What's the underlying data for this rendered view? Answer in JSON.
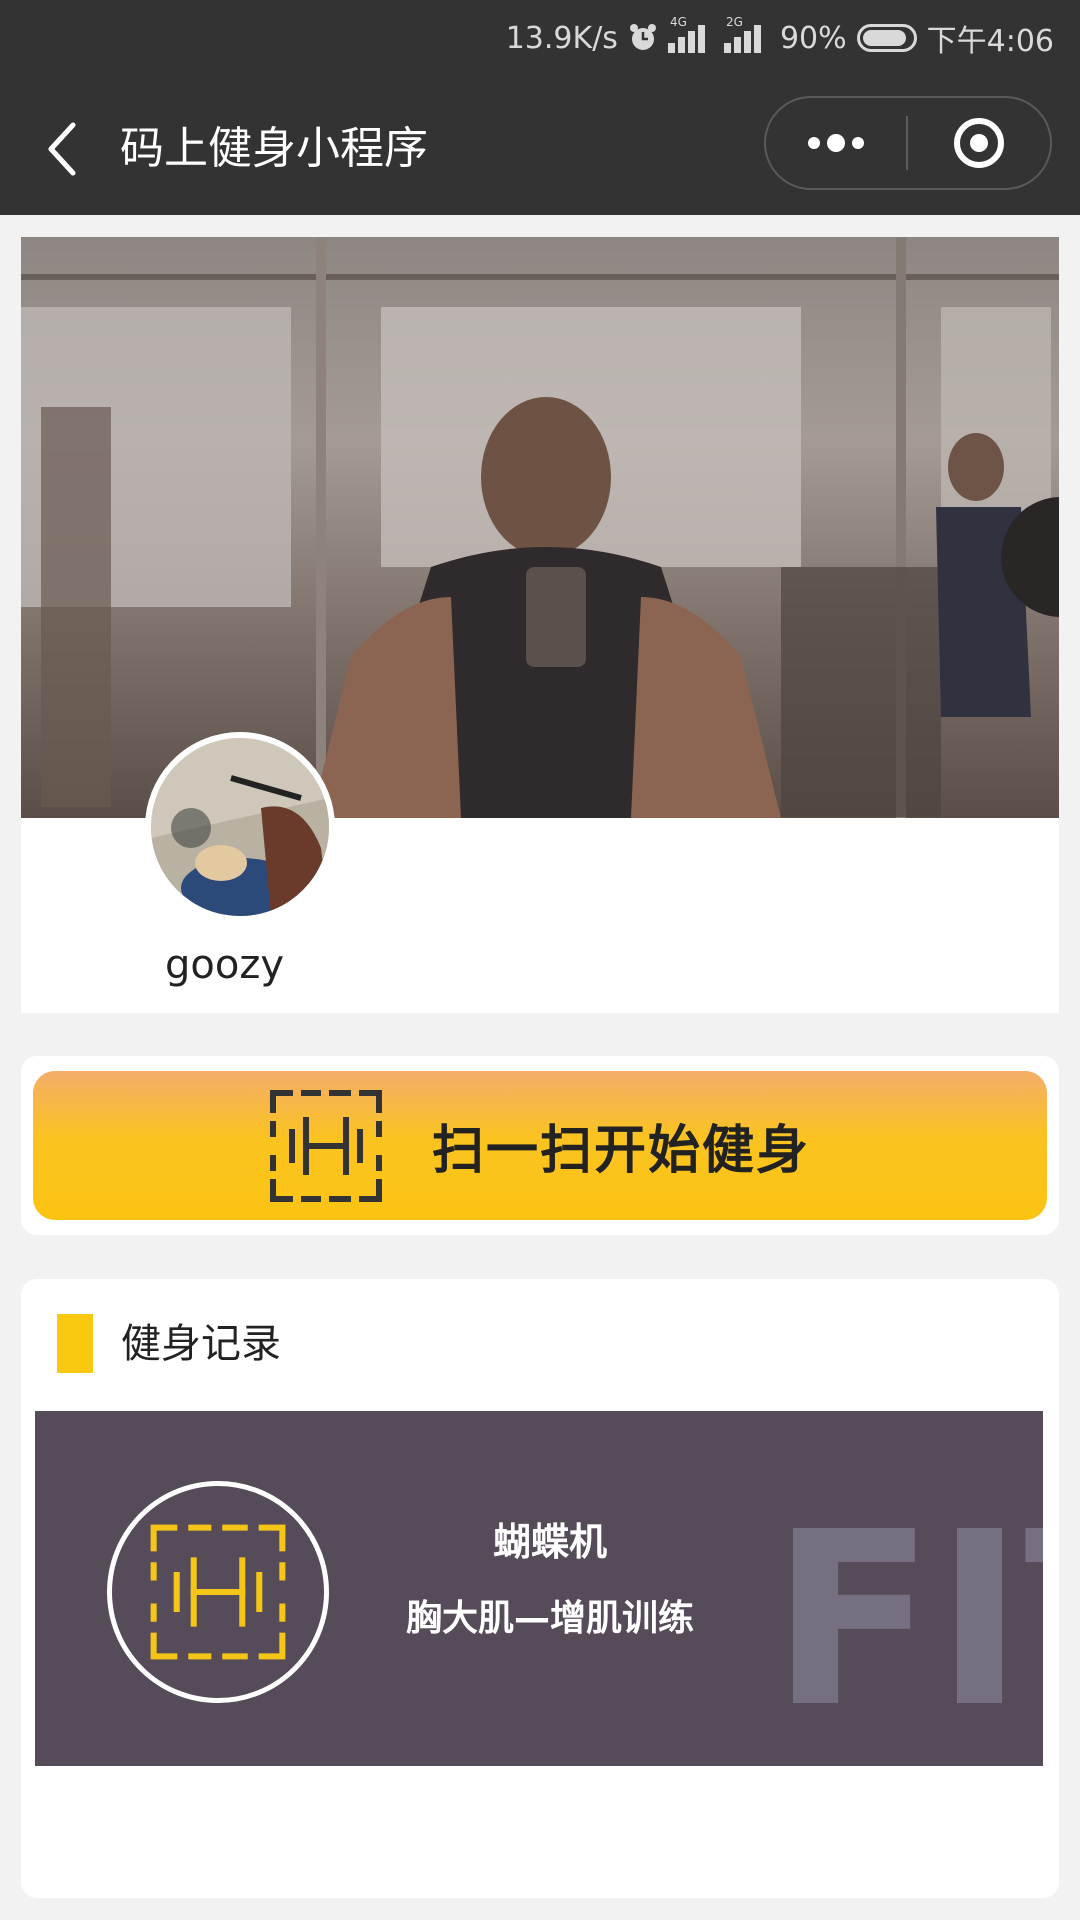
{
  "status_bar": {
    "net_speed": "13.9K/s",
    "sim1_tag": "4G",
    "sim2_tag": "2G",
    "battery": "90%",
    "time": "下午4:06"
  },
  "header": {
    "title": "码上健身小程序",
    "back_icon": "chevron-left-icon",
    "more_icon": "more-dots-icon",
    "close_icon": "target-circle-icon"
  },
  "profile": {
    "username": "goozy"
  },
  "scan": {
    "label": "扫一扫开始健身",
    "icon": "dumbbell-scan-icon"
  },
  "records": {
    "title": "健身记录",
    "items": [
      {
        "name": "蝴蝶机",
        "description": "胸大肌—增肌训练",
        "watermark": "FIT"
      }
    ]
  },
  "colors": {
    "topbar": "#333333",
    "accent_yellow": "#fbc412",
    "record_bg": "#564b58"
  }
}
